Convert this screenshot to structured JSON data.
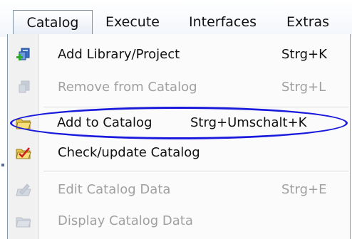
{
  "menubar": {
    "items": [
      {
        "label": "Catalog"
      },
      {
        "label": "Execute"
      },
      {
        "label": "Interfaces"
      },
      {
        "label": "Extras"
      }
    ]
  },
  "dropdown": {
    "items": [
      {
        "label": "Add Library/Project",
        "shortcut": "Strg+K",
        "enabled": true,
        "icon": "add-library-icon"
      },
      {
        "label": "Remove from Catalog",
        "shortcut": "Strg+L",
        "enabled": false,
        "icon": "remove-from-catalog-icon"
      },
      {
        "label": "Add to Catalog",
        "shortcut": "Strg+Umschalt+K",
        "enabled": true,
        "icon": "add-to-catalog-icon"
      },
      {
        "label": "Check/update Catalog",
        "shortcut": "",
        "enabled": true,
        "icon": "check-catalog-icon"
      },
      {
        "label": "Edit Catalog Data",
        "shortcut": "Strg+E",
        "enabled": false,
        "icon": "edit-catalog-data-icon"
      },
      {
        "label": "Display Catalog Data",
        "shortcut": "",
        "enabled": false,
        "icon": "display-catalog-data-icon"
      }
    ]
  },
  "annotation": {
    "ellipse_color": "#1a1adc"
  }
}
